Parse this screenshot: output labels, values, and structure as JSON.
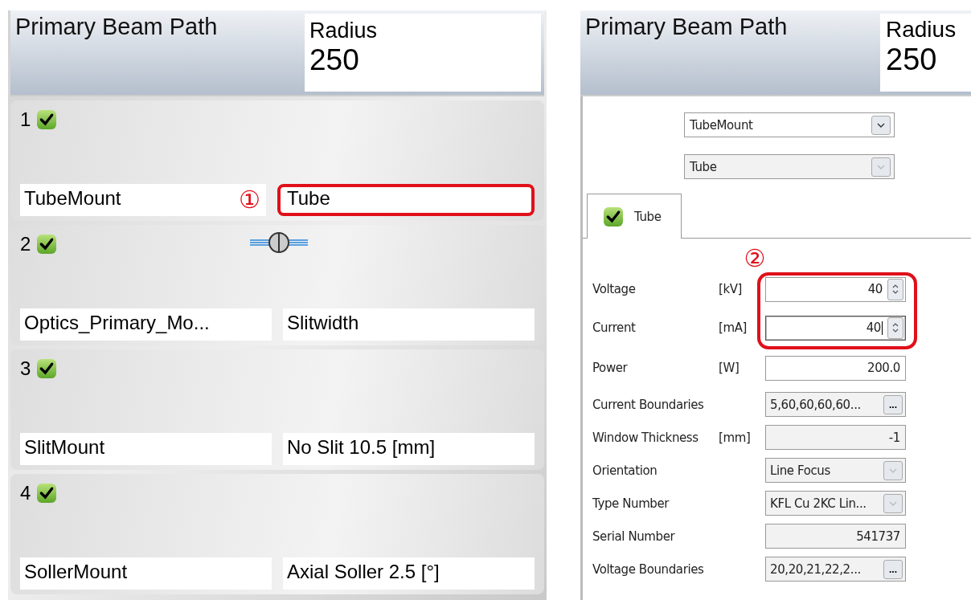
{
  "left": {
    "title": "Primary Beam Path",
    "radius_label": "Radius",
    "radius_value": "250",
    "slots": [
      {
        "number": "1",
        "checked": true,
        "mount": "TubeMount",
        "value": "Tube",
        "highlighted": true,
        "callout": "①"
      },
      {
        "number": "2",
        "checked": true,
        "mount": "Optics_Primary_Mo...",
        "value": "Slitwidth",
        "highlighted": false
      },
      {
        "number": "3",
        "checked": true,
        "mount": "SlitMount",
        "value": "No Slit 10.5 [mm]",
        "highlighted": false
      },
      {
        "number": "4",
        "checked": true,
        "mount": "SollerMount",
        "value": "Axial Soller 2.5 [°]",
        "highlighted": false
      }
    ]
  },
  "right": {
    "title": "Primary Beam Path",
    "radius_label": "Radius",
    "radius_value": "250",
    "selects": [
      {
        "value": "TubeMount",
        "disabled": false
      },
      {
        "value": "Tube",
        "disabled": true
      }
    ],
    "tab": {
      "label": "Tube",
      "checked": true,
      "selected": true
    },
    "callout": "②",
    "fields": [
      {
        "kind": "spin",
        "label": "Voltage",
        "unit": "[kV]",
        "value": "40",
        "highlighted": true,
        "focused": false
      },
      {
        "kind": "spin",
        "label": "Current",
        "unit": "[mA]",
        "value": "40",
        "highlighted": true,
        "focused": true
      },
      {
        "kind": "text",
        "label": "Power",
        "unit": "[W]",
        "value": "200.0",
        "highlighted": false,
        "focused": false
      },
      {
        "kind": "browse",
        "label": "Current Boundaries",
        "value": "5,60,60,60,60...",
        "browse_label": "...",
        "highlighted": false,
        "focused": false
      },
      {
        "kind": "readonly",
        "label": "Window Thickness",
        "unit": "[mm]",
        "value": "-1",
        "highlighted": false,
        "focused": false
      },
      {
        "kind": "select",
        "label": "Orientation",
        "value": "Line Focus",
        "highlighted": false,
        "focused": false
      },
      {
        "kind": "select",
        "label": "Type Number",
        "value": "KFL Cu 2KC Lin...",
        "highlighted": false,
        "focused": false
      },
      {
        "kind": "readonly",
        "label": "Serial Number",
        "value": "541737",
        "highlighted": false,
        "focused": false
      },
      {
        "kind": "browse",
        "label": "Voltage Boundaries",
        "value": "20,20,21,22,2...",
        "browse_label": "...",
        "highlighted": false,
        "focused": false
      }
    ]
  }
}
